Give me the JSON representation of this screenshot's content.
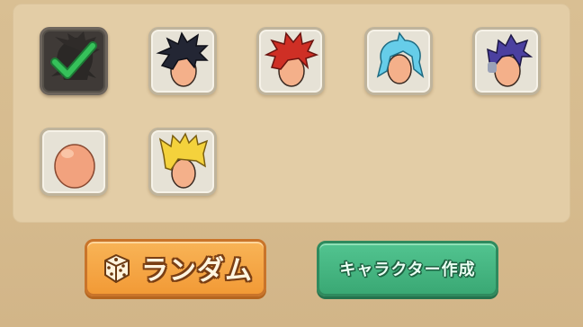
{
  "hair_options": [
    {
      "name": "shadow-spiky",
      "selected": true,
      "color": "#3a3633"
    },
    {
      "name": "dark-spiky",
      "selected": false,
      "color": "#1f2230"
    },
    {
      "name": "red-spiky",
      "selected": false,
      "color": "#c42a22"
    },
    {
      "name": "cyan-swept",
      "selected": false,
      "color": "#5fc8e6"
    },
    {
      "name": "purple-mohawk",
      "selected": false,
      "color": "#4a3f9a"
    },
    {
      "name": "bald",
      "selected": false,
      "color": "#f0a07a"
    },
    {
      "name": "blonde-flat-top",
      "selected": false,
      "color": "#f3d13a"
    }
  ],
  "buttons": {
    "random_label": "ランダム",
    "create_label": "キャラクター作成"
  },
  "colors": {
    "random_button": "#f29a36",
    "create_button": "#3aa874",
    "check": "#2fae4e"
  }
}
